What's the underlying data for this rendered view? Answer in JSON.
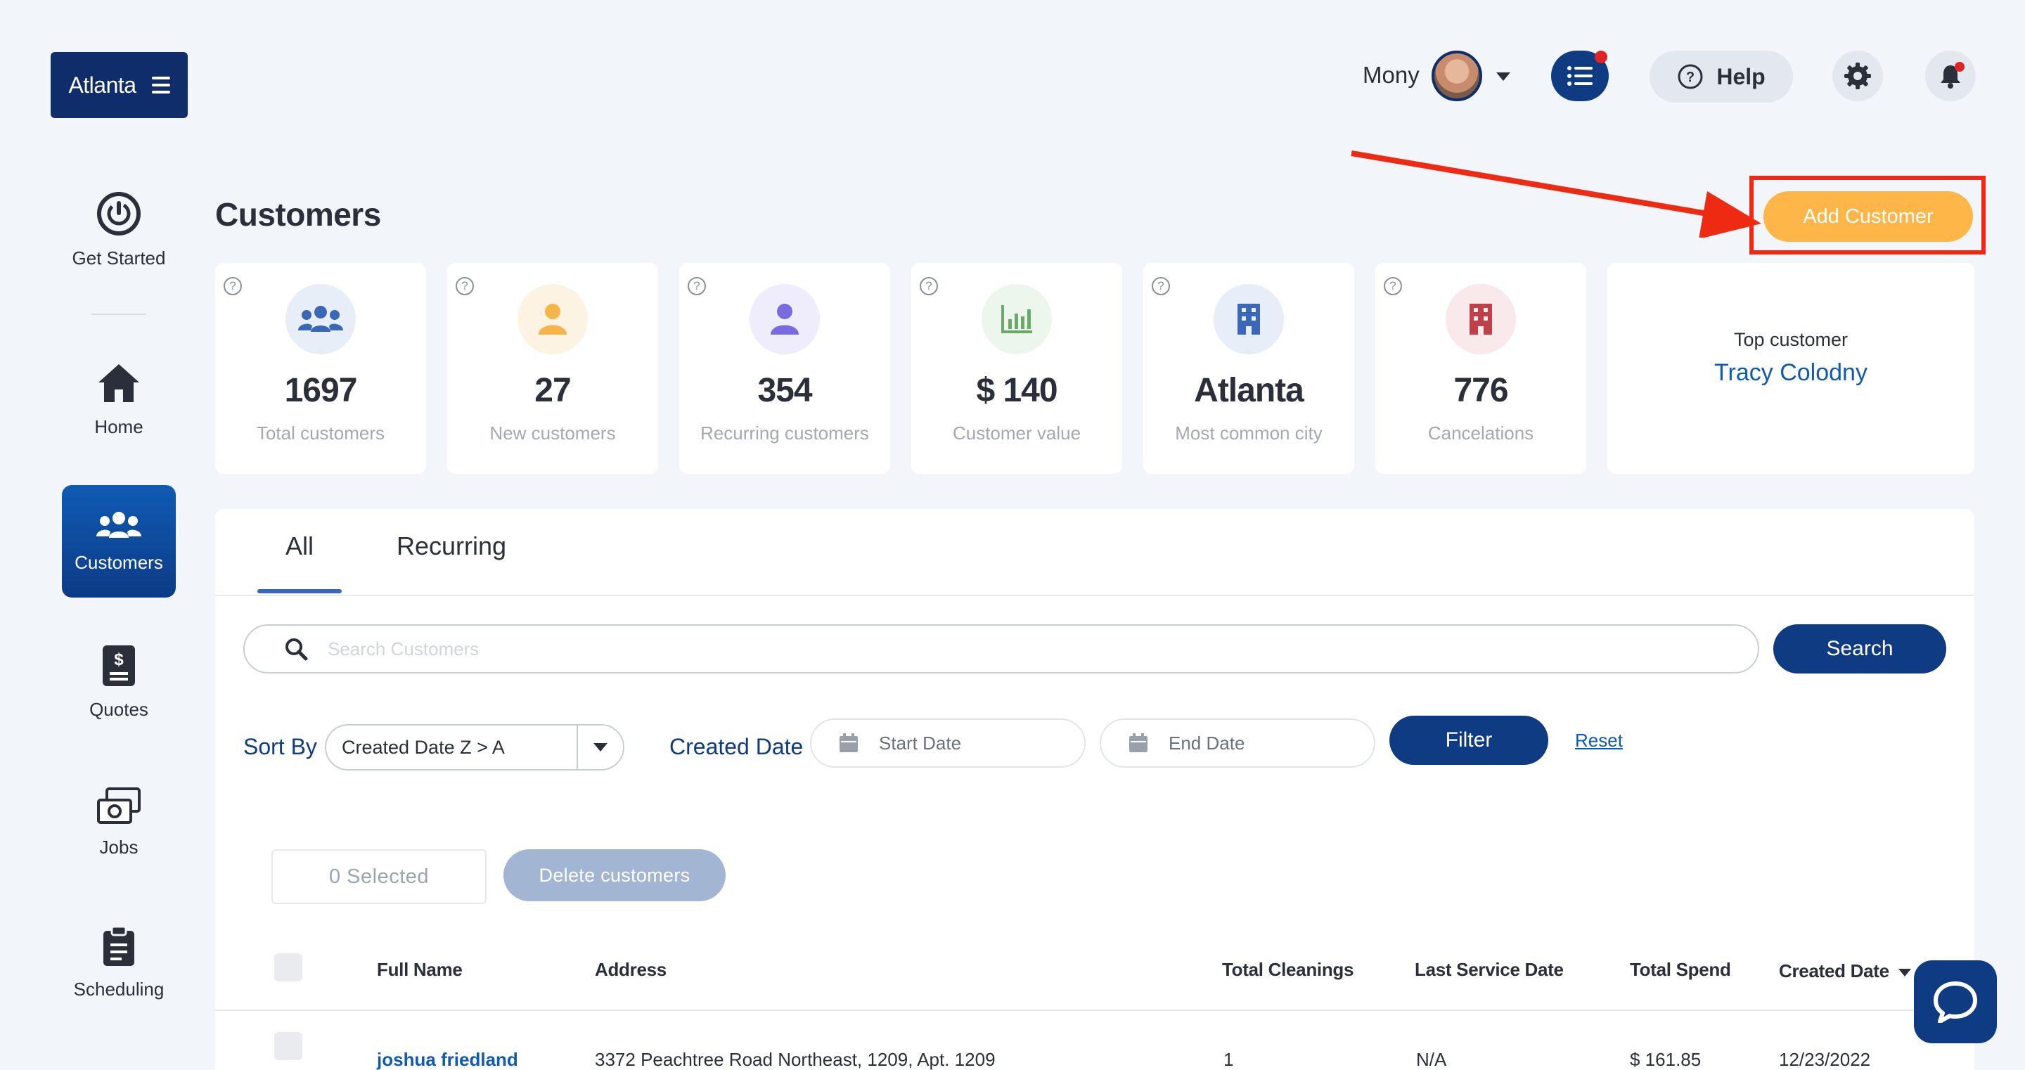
{
  "brand": {
    "label": "Atlanta"
  },
  "topbar": {
    "user_name": "Mony",
    "help_label": "Help"
  },
  "sidebar": {
    "items": [
      {
        "label": "Get Started",
        "icon": "power-icon"
      },
      {
        "label": "Home",
        "icon": "home-icon"
      },
      {
        "label": "Customers",
        "icon": "users-icon",
        "active": true
      },
      {
        "label": "Quotes",
        "icon": "quote-icon"
      },
      {
        "label": "Jobs",
        "icon": "jobs-icon"
      },
      {
        "label": "Scheduling",
        "icon": "clipboard-icon"
      }
    ]
  },
  "page": {
    "title": "Customers",
    "add_button": "Add Customer"
  },
  "stats": [
    {
      "value": "1697",
      "label": "Total customers",
      "icon": "users-icon",
      "icon_bg": "#e8eef7",
      "icon_color": "#3a67b8"
    },
    {
      "value": "27",
      "label": "New customers",
      "icon": "user-icon",
      "icon_bg": "#fdf3e3",
      "icon_color": "#f5b54a"
    },
    {
      "value": "354",
      "label": "Recurring customers",
      "icon": "user-icon",
      "icon_bg": "#efedfb",
      "icon_color": "#7a6ae0"
    },
    {
      "value": "$ 140",
      "label": "Customer value",
      "icon": "chart-icon",
      "icon_bg": "#edf6ec",
      "icon_color": "#6aaa66"
    },
    {
      "value": "Atlanta",
      "label": "Most common city",
      "icon": "building-icon",
      "icon_bg": "#e8eef7",
      "icon_color": "#3a67b8"
    },
    {
      "value": "776",
      "label": "Cancelations",
      "icon": "building-icon",
      "icon_bg": "#f9e9ea",
      "icon_color": "#c0404a"
    }
  ],
  "top_customer": {
    "label": "Top customer",
    "name": "Tracy Colodny"
  },
  "tabs": [
    {
      "label": "All"
    },
    {
      "label": "Recurring"
    }
  ],
  "search": {
    "placeholder": "Search Customers",
    "button": "Search"
  },
  "filters": {
    "sort_label": "Sort By",
    "sort_value": "Created Date Z > A",
    "created_label": "Created Date",
    "start_placeholder": "Start Date",
    "end_placeholder": "End Date",
    "filter_button": "Filter",
    "reset_link": "Reset"
  },
  "bulk": {
    "selected": "0 Selected",
    "delete_button": "Delete customers"
  },
  "table": {
    "headers": [
      "Full Name",
      "Address",
      "Total Cleanings",
      "Last Service Date",
      "Total Spend",
      "Created Date"
    ],
    "rows": [
      {
        "name": "joshua friedland",
        "address": "3372 Peachtree Road Northeast, 1209, Apt. 1209",
        "cleanings": "1",
        "last_service": "N/A",
        "spend": "$ 161.85",
        "created": "12/23/2022"
      }
    ]
  },
  "colors": {
    "primary": "#0f3b83",
    "accent": "#ffb648",
    "highlight": "#ee2a13"
  }
}
